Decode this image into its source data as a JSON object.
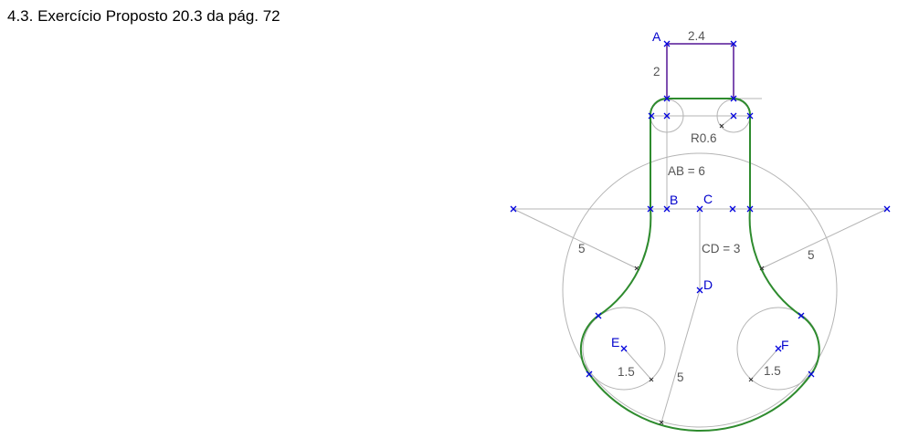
{
  "title": "4.3. Exercício Proposto 20.3 da pág. 72",
  "points": {
    "A": "A",
    "B": "B",
    "C": "C",
    "D": "D",
    "E": "E",
    "F": "F"
  },
  "dimensions": {
    "rect_width": "2.4",
    "rect_height": "2",
    "fillet_radius": "R0.6",
    "ab_length": "AB = 6",
    "cd_length": "CD = 3",
    "left_radius": "5",
    "right_radius": "5",
    "bottom_radius": "5",
    "e_radius": "1.5",
    "f_radius": "1.5"
  },
  "colors": {
    "outline": "#2e8b2e",
    "rectangle": "#7e4fb0",
    "construction": "#b4b4b4",
    "points": "#0000dd"
  }
}
